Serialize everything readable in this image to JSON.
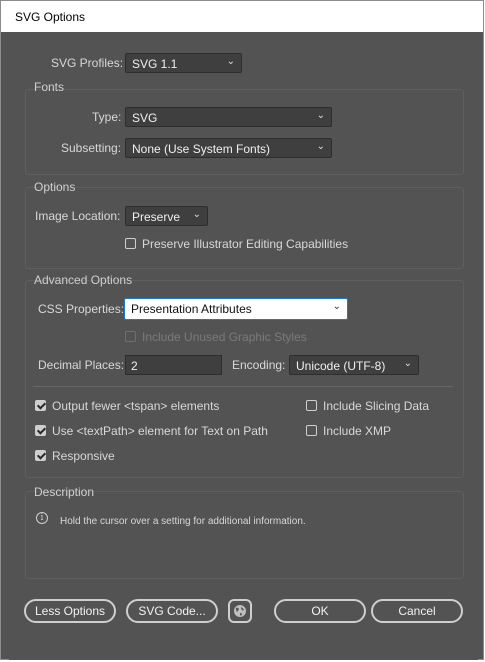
{
  "window": {
    "title": "SVG Options"
  },
  "profiles": {
    "label": "SVG Profiles:",
    "value": "SVG 1.1"
  },
  "fonts": {
    "section": "Fonts",
    "type_label": "Type:",
    "type_value": "SVG",
    "subsetting_label": "Subsetting:",
    "subsetting_value": "None (Use System Fonts)"
  },
  "options": {
    "section": "Options",
    "image_location_label": "Image Location:",
    "image_location_value": "Preserve",
    "preserve_label": "Preserve Illustrator Editing Capabilities"
  },
  "advanced": {
    "section": "Advanced Options",
    "css_label": "CSS Properties:",
    "css_value": "Presentation Attributes",
    "include_unused_label": "Include Unused Graphic Styles",
    "decimal_label": "Decimal Places:",
    "decimal_value": "2",
    "encoding_label": "Encoding:",
    "encoding_value": "Unicode (UTF-8)",
    "checkboxes": {
      "output_fewer": "Output fewer <tspan> elements",
      "use_textpath": "Use <textPath> element for Text on Path",
      "responsive": "Responsive",
      "include_slicing": "Include Slicing Data",
      "include_xmp": "Include XMP"
    }
  },
  "description": {
    "section": "Description",
    "text": "Hold the cursor over a setting for additional information."
  },
  "buttons": {
    "less_options": "Less Options",
    "svg_code": "SVG Code...",
    "ok": "OK",
    "cancel": "Cancel"
  },
  "icons": {
    "chevron": "chevron-down-icon",
    "info": "info-icon",
    "globe": "globe-icon"
  }
}
